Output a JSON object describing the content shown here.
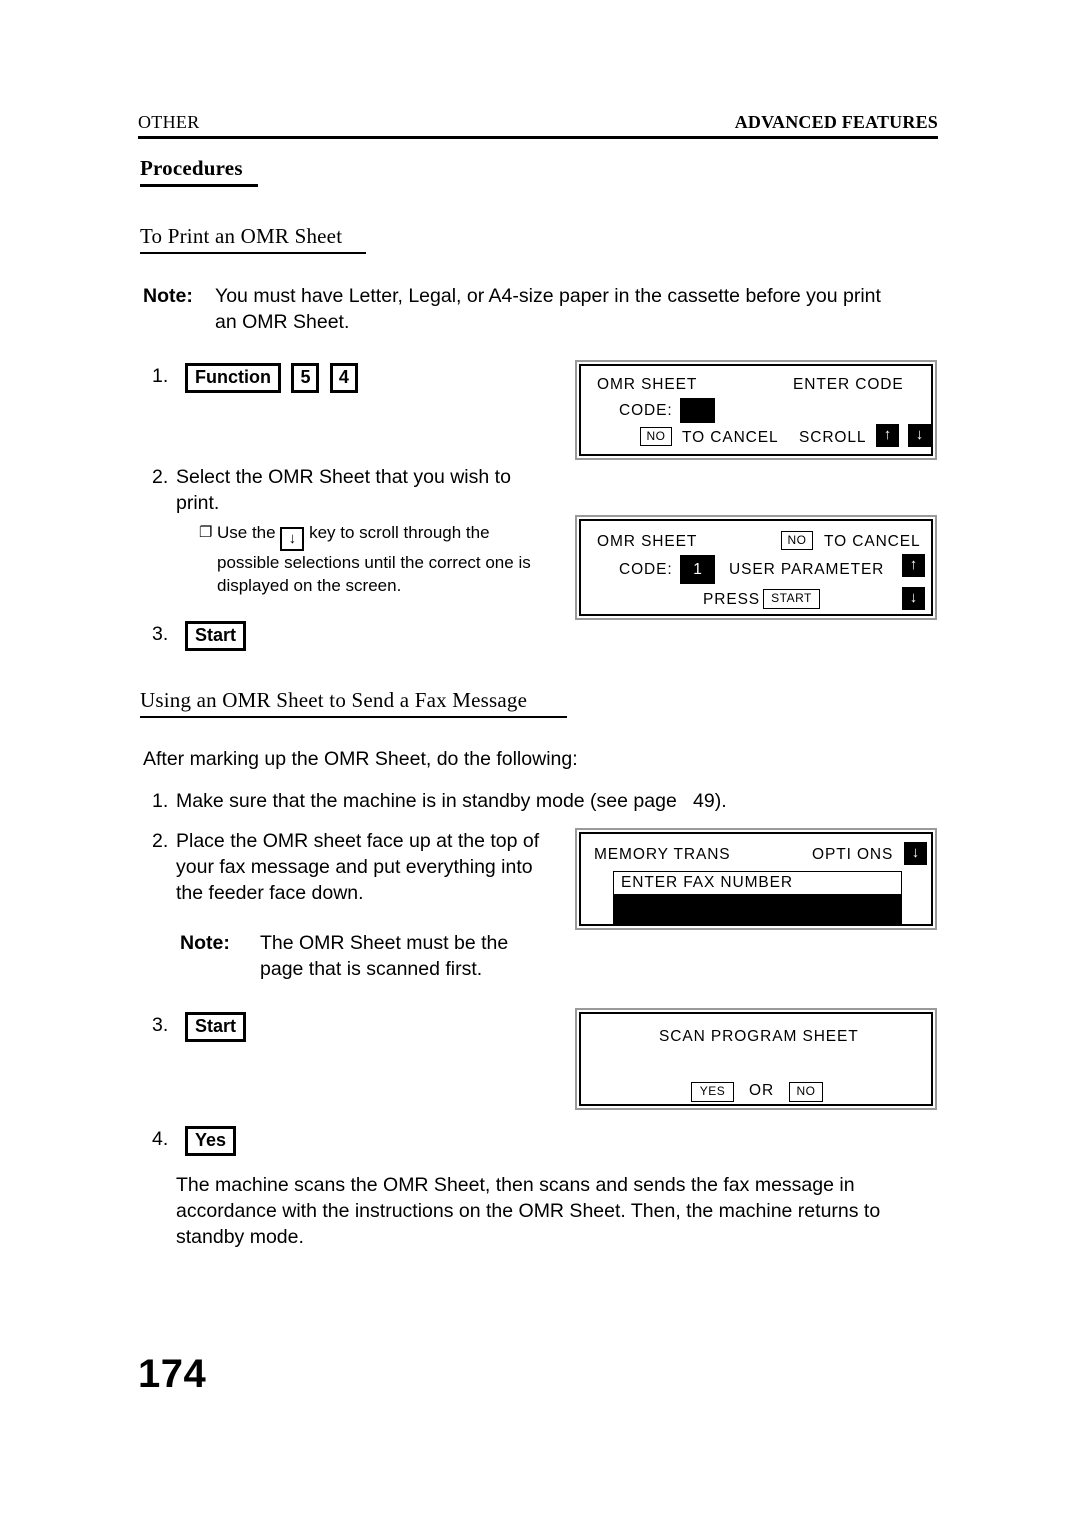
{
  "header": {
    "left": "OTHER",
    "right": "ADVANCED FEATURES"
  },
  "section_title": "Procedures",
  "subsections": [
    {
      "title": "To Print an OMR Sheet"
    },
    {
      "title": "Using an OMR Sheet to Send a Fax Message"
    }
  ],
  "notes": {
    "label": "Note:",
    "print_note": "You must have Letter, Legal, or A4-size paper in the cassette before you print an OMR Sheet.",
    "omr_first_note": "The OMR Sheet must be the page that is scanned first."
  },
  "print_steps": {
    "step1": {
      "number": "1.",
      "keys": [
        "Function",
        "5",
        "4"
      ]
    },
    "step2": {
      "number": "2.",
      "text": "Select the OMR Sheet that you wish to print.",
      "bullet": {
        "glyph": "❐",
        "text_before": "Use the",
        "key_glyph": "↓",
        "text_after": "key to scroll through the possible selections until the correct one is displayed on the screen."
      }
    },
    "step3": {
      "number": "3.",
      "key": "Start"
    }
  },
  "send_section": {
    "intro": "After marking up the OMR Sheet, do the following:",
    "step1": {
      "number": "1.",
      "text": "Make sure that the machine is in standby mode (see page   49)."
    },
    "step2": {
      "number": "2.",
      "text": "Place the OMR sheet face up at the top of your fax message and put everything into the feeder face down."
    },
    "step3": {
      "number": "3.",
      "key": "Start"
    },
    "step4": {
      "number": "4.",
      "key": "Yes"
    },
    "closing": "The machine scans the OMR Sheet, then scans and sends the fax message in accordance with the instructions on the OMR Sheet. Then, the machine returns to standby mode."
  },
  "lcd_panels": {
    "panel1": {
      "title": "OMR SHEET",
      "right_label": "ENTER CODE",
      "code_label": "CODE:",
      "code_value": "",
      "cancel_key": "NO",
      "cancel_label": "TO CANCEL",
      "scroll_label": "SCROLL",
      "arrow_up": "↑",
      "arrow_down": "↓"
    },
    "panel2": {
      "title": "OMR SHEET",
      "cancel_key": "NO",
      "cancel_label": "TO CANCEL",
      "code_label": "CODE:",
      "code_value": "1",
      "selection": "USER PARAMETER",
      "press_label": "PRESS",
      "press_key": "START",
      "arrow_up": "↑",
      "arrow_down": "↓"
    },
    "panel3": {
      "title": "MEMORY TRANS",
      "options_label": "OPTI ONS",
      "arrow_down": "↓",
      "field_text": "ENTER FAX NUMBER"
    },
    "panel4": {
      "title": "SCAN PROGRAM SHEET",
      "yes_key": "YES",
      "or_label": "OR",
      "no_key": "NO"
    }
  },
  "page_number": "174"
}
